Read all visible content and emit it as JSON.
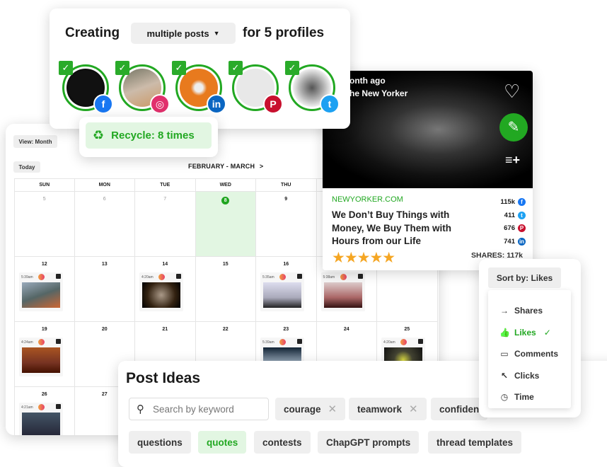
{
  "calendar": {
    "view_label": "View: Month",
    "today_label": "Today",
    "range_label": "FEBRUARY - MARCH",
    "next_icon": "chevron-right-icon",
    "day_headers": [
      "SUN",
      "MON",
      "TUE",
      "WED",
      "THU"
    ],
    "weeks": [
      [
        {
          "date": "5",
          "past": true
        },
        {
          "date": "6",
          "past": true
        },
        {
          "date": "7",
          "past": true
        },
        {
          "date": "8",
          "today": true
        },
        {
          "date": "9"
        },
        null,
        null
      ],
      [
        {
          "date": "12",
          "event": {
            "time": "5:39am"
          }
        },
        {
          "date": "13"
        },
        {
          "date": "14",
          "event": {
            "time": "4:20am"
          }
        },
        {
          "date": "15"
        },
        {
          "date": "16",
          "event": {
            "time": "5:35am"
          }
        },
        {
          "date": "",
          "event": {
            "time": "5:38am"
          }
        },
        null
      ],
      [
        {
          "date": "19",
          "event": {
            "time": "4:24am"
          }
        },
        {
          "date": "20"
        },
        {
          "date": "21"
        },
        {
          "date": "22"
        },
        {
          "date": "23",
          "event": {
            "time": "5:39am"
          }
        },
        {
          "date": "24"
        },
        {
          "date": "25",
          "event": {
            "time": "4:20am"
          }
        }
      ],
      [
        {
          "date": "26",
          "event": {
            "time": "4:21am"
          }
        },
        {
          "date": "27"
        },
        null,
        null,
        null,
        null,
        null
      ]
    ]
  },
  "composer": {
    "creating_label": "Creating",
    "mode_value": "multiple posts",
    "suffix_label": "for 5 profiles",
    "profiles": [
      {
        "network": "facebook",
        "glyph": "f",
        "color": "#1877f2"
      },
      {
        "network": "instagram",
        "glyph": "◎",
        "color": "#e1306c"
      },
      {
        "network": "linkedin",
        "glyph": "in",
        "color": "#0a66c2"
      },
      {
        "network": "pinterest",
        "glyph": "P",
        "color": "#c8102e"
      },
      {
        "network": "twitter",
        "glyph": "t",
        "color": "#1da1f2"
      }
    ],
    "recycle_label": "Recycle: 8 times"
  },
  "article": {
    "time_ago": "onth ago",
    "publisher": "he New Yorker",
    "source": "NEWYORKER.COM",
    "title": "We Don’t Buy Things with Money, We Buy Them with Hours from our Life",
    "rating": 5,
    "stars": "★★★★★",
    "counts": [
      {
        "value": "115k",
        "network": "facebook",
        "glyph": "f",
        "color": "#1877f2"
      },
      {
        "value": "411",
        "network": "twitter",
        "glyph": "t",
        "color": "#1da1f2"
      },
      {
        "value": "676",
        "network": "pinterest",
        "glyph": "P",
        "color": "#c8102e"
      },
      {
        "value": "741",
        "network": "linkedin",
        "glyph": "in",
        "color": "#0a66c2"
      }
    ],
    "shares_label": "SHARES: 117k"
  },
  "sort": {
    "button_label": "Sort by: Likes",
    "items": [
      {
        "label": "Shares",
        "icon": "arrow-right-icon",
        "glyph": "→"
      },
      {
        "label": "Likes",
        "icon": "thumbs-up-icon",
        "glyph": "👍",
        "selected": true
      },
      {
        "label": "Comments",
        "icon": "comment-icon",
        "glyph": "▭"
      },
      {
        "label": "Clicks",
        "icon": "cursor-icon",
        "glyph": "↖"
      },
      {
        "label": "Time",
        "icon": "clock-icon",
        "glyph": "◷"
      }
    ]
  },
  "ideas": {
    "title": "Post Ideas",
    "search_placeholder": "Search by keyword",
    "filter_chips": [
      "courage",
      "teamwork",
      "confiden"
    ],
    "categories": [
      "questions",
      "quotes",
      "contests",
      "ChapGPT prompts",
      "thread templates"
    ],
    "selected_category": "quotes"
  },
  "colors": {
    "accent": "#22a822",
    "accent_light": "#e2f6e2",
    "star": "#f5a623"
  }
}
